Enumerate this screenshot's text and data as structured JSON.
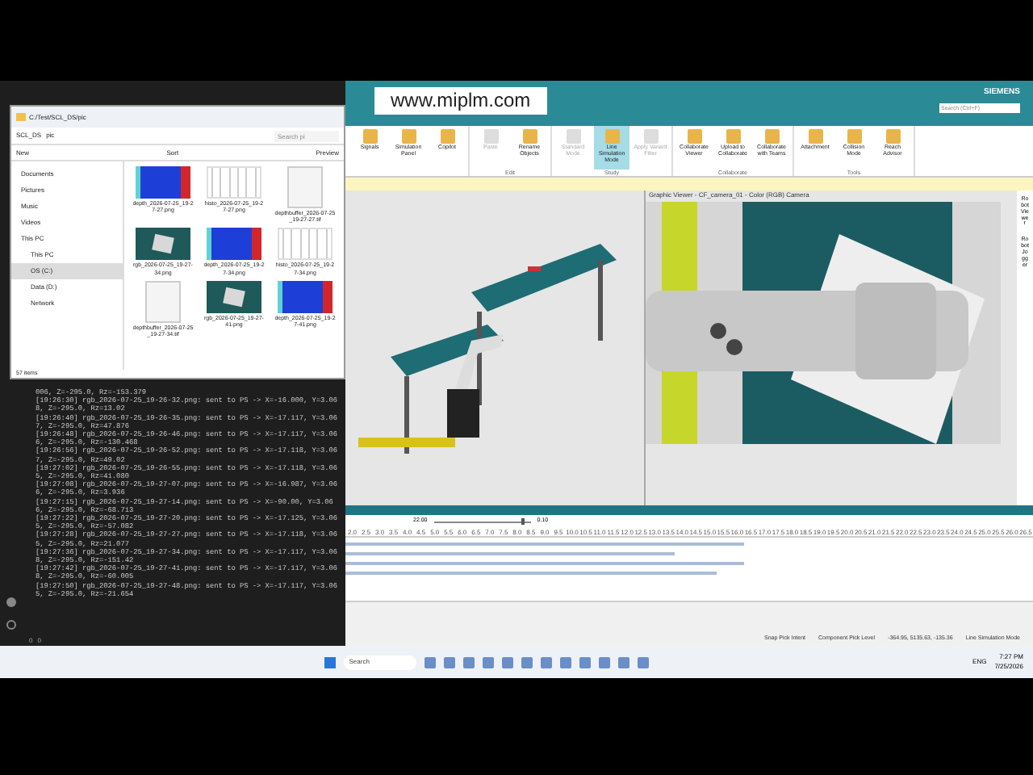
{
  "explorer": {
    "title": "C:/Test/SCL_DS/pic",
    "breadcrumb": [
      "SCL_DS",
      "pic"
    ],
    "search": {
      "placeholder": "Search pi"
    },
    "toolbar": [
      "New",
      "Sort",
      "Preview"
    ],
    "sidebar": [
      {
        "label": "Documents",
        "kind": "pinned",
        "selected": false
      },
      {
        "label": "Pictures",
        "kind": "pinned",
        "selected": false
      },
      {
        "label": "Music",
        "kind": "pinned",
        "selected": false
      },
      {
        "label": "Videos",
        "kind": "pinned",
        "selected": false
      },
      {
        "label": "This PC",
        "kind": "pinned",
        "selected": false
      },
      {
        "label": "This PC",
        "kind": "drive",
        "selected": false
      },
      {
        "label": "OS (C:)",
        "kind": "drive",
        "selected": true
      },
      {
        "label": "Data (D:)",
        "kind": "drive",
        "selected": false
      },
      {
        "label": "Network",
        "kind": "drive",
        "selected": false
      }
    ],
    "files": [
      {
        "name": "depth_2026-07-25_19-27-27.png",
        "kind": "depth"
      },
      {
        "name": "histo_2026-07-25_19-27-27.png",
        "kind": "histo"
      },
      {
        "name": "depthbuffer_2026-07-25_19-27-27.tif",
        "kind": "blank"
      },
      {
        "name": "rgb_2026-07-25_19-27-34.png",
        "kind": "rgb"
      },
      {
        "name": "depth_2026-07-25_19-27-34.png",
        "kind": "depth"
      },
      {
        "name": "histo_2026-07-25_19-27-34.png",
        "kind": "histo"
      },
      {
        "name": "depthbuffer_2026-07-25_19-27-34.tif",
        "kind": "blank"
      },
      {
        "name": "rgb_2026-07-25_19-27-41.png",
        "kind": "rgb"
      },
      {
        "name": "depth_2026-07-25_19-27-41.png",
        "kind": "depth"
      }
    ],
    "status": "57 items"
  },
  "terminal": {
    "lines": [
      "006, Z=-295.0, Rz=-153.379",
      "[19:26:30] rgb_2026-07-25_19-26-32.png: sent to PS -> X=-16.000, Y=3.068, Z=-295.0, Rz=13.02",
      "[19:26:40] rgb_2026-07-25_19-26-35.png: sent to PS -> X=-17.117, Y=3.067, Z=-295.0, Rz=47.876",
      "[19:26:48] rgb_2026-07-25_19-26-46.png: sent to PS -> X=-17.117, Y=3.066, Z=-295.0, Rz=-130.468",
      "[19:26:56] rgb_2026-07-25_19-26-52.png: sent to PS -> X=-17.118, Y=3.067, Z=-295.0, Rz=49.02",
      "[19:27:02] rgb_2026-07-25_19-26-55.png: sent to PS -> X=-17.118, Y=3.065, Z=-295.0, Rz=41.080",
      "[19:27:08] rgb_2026-07-25_19-27-07.png: sent to PS -> X=-16.987, Y=3.066, Z=-295.0, Rz=3.936",
      "[19:27:15] rgb_2026-07-25_19-27-14.png: sent to PS -> X=-90.00, Y=3.066, Z=-295.0, Rz=-68.713",
      "[19:27:22] rgb_2026-07-25_19-27-20.png: sent to PS -> X=-17.125, Y=3.065, Z=-295.0, Rz=-57.082",
      "[19:27:28] rgb_2026-07-25_19-27-27.png: sent to PS -> X=-17.118, Y=3.065, Z=-295.0, Rz=21.077",
      "[19:27:36] rgb_2026-07-25_19-27-34.png: sent to PS -> X=-17.117, Y=3.068, Z=-295.0, Rz=-151.42",
      "[19:27:42] rgb_2026-07-25_19-27-41.png: sent to PS -> X=-17.117, Y=3.068, Z=-295.0, Rz=-60.005",
      "[19:27:50] rgb_2026-07-25_19-27-48.png: sent to PS -> X=-17.117, Y=3.065, Z=-295.0, Rz=-21.654"
    ],
    "status": [
      "0",
      "0"
    ]
  },
  "app": {
    "logo": "www.miplm.com",
    "brand": "SIEMENS",
    "search": {
      "placeholder": "Search (Ctrl+F)"
    },
    "ribbon": [
      {
        "buttons": [
          {
            "label": "Signals",
            "selected": false,
            "disabled": false
          },
          {
            "label": "Simulation Panel",
            "selected": false,
            "disabled": false
          },
          {
            "label": "Copilot",
            "selected": false,
            "disabled": false
          }
        ]
      },
      {
        "label": "Edit",
        "buttons": [
          {
            "label": "Paste",
            "selected": false,
            "disabled": true
          },
          {
            "label": "Rename Objects",
            "selected": false,
            "disabled": false
          }
        ]
      },
      {
        "label": "Study",
        "buttons": [
          {
            "label": "Standard Mode",
            "selected": false,
            "disabled": true
          },
          {
            "label": "Line Simulation Mode",
            "selected": true,
            "disabled": false
          },
          {
            "label": "Apply Variant Filter",
            "selected": false,
            "disabled": true
          }
        ]
      },
      {
        "label": "Collaborate",
        "buttons": [
          {
            "label": "Collaborate Viewer",
            "selected": false,
            "disabled": false
          },
          {
            "label": "Upload to Collaborate",
            "selected": false,
            "disabled": false
          },
          {
            "label": "Collaborate with Teams",
            "selected": false,
            "disabled": false
          }
        ]
      },
      {
        "label": "Tools",
        "buttons": [
          {
            "label": "Attachment",
            "selected": false,
            "disabled": false
          },
          {
            "label": "Collision Mode",
            "selected": false,
            "disabled": false
          },
          {
            "label": "Reach Advisor",
            "selected": false,
            "disabled": false
          }
        ]
      }
    ],
    "camera_title": "Graphic Viewer - CF_camera_01 - Color (RGB) Camera",
    "side_tabs": [
      "Robot Viewer",
      "Robot Jogger"
    ],
    "timeline": {
      "time": "22.00",
      "step": "0.10",
      "zoom": {
        "level": 0.9
      },
      "ticks": [
        "2.0",
        "2.5",
        "3.0",
        "3.5",
        "4.0",
        "4.5",
        "5.0",
        "5.5",
        "6.0",
        "6.5",
        "7.0",
        "7.5",
        "8.0",
        "8.5",
        "9.0",
        "9.5",
        "10.0",
        "10.5",
        "11.0",
        "11.5",
        "12.0",
        "12.5",
        "13.0",
        "13.5",
        "14.0",
        "14.5",
        "15.0",
        "15.5",
        "16.0",
        "16.5",
        "17.0",
        "17.5",
        "18.0",
        "18.5",
        "19.0",
        "19.5",
        "20.0",
        "20.5",
        "21.0",
        "21.5",
        "22.0",
        "22.5",
        "23.0",
        "23.5",
        "24.0",
        "24.5",
        "25.0",
        "25.5",
        "26.0",
        "26.5"
      ],
      "bars": [
        {
          "level": 0.58
        },
        {
          "level": 0.48
        },
        {
          "level": 0.58
        },
        {
          "level": 0.54
        }
      ]
    },
    "status": [
      "Snap Pick Intent",
      "Component Pick Level",
      "-364.95, 5135.63, -135.36",
      "Line Simulation Mode"
    ]
  },
  "taskbar": {
    "search": "Search",
    "language": "ENG",
    "time": "7:27 PM",
    "date": "7/25/2026"
  }
}
